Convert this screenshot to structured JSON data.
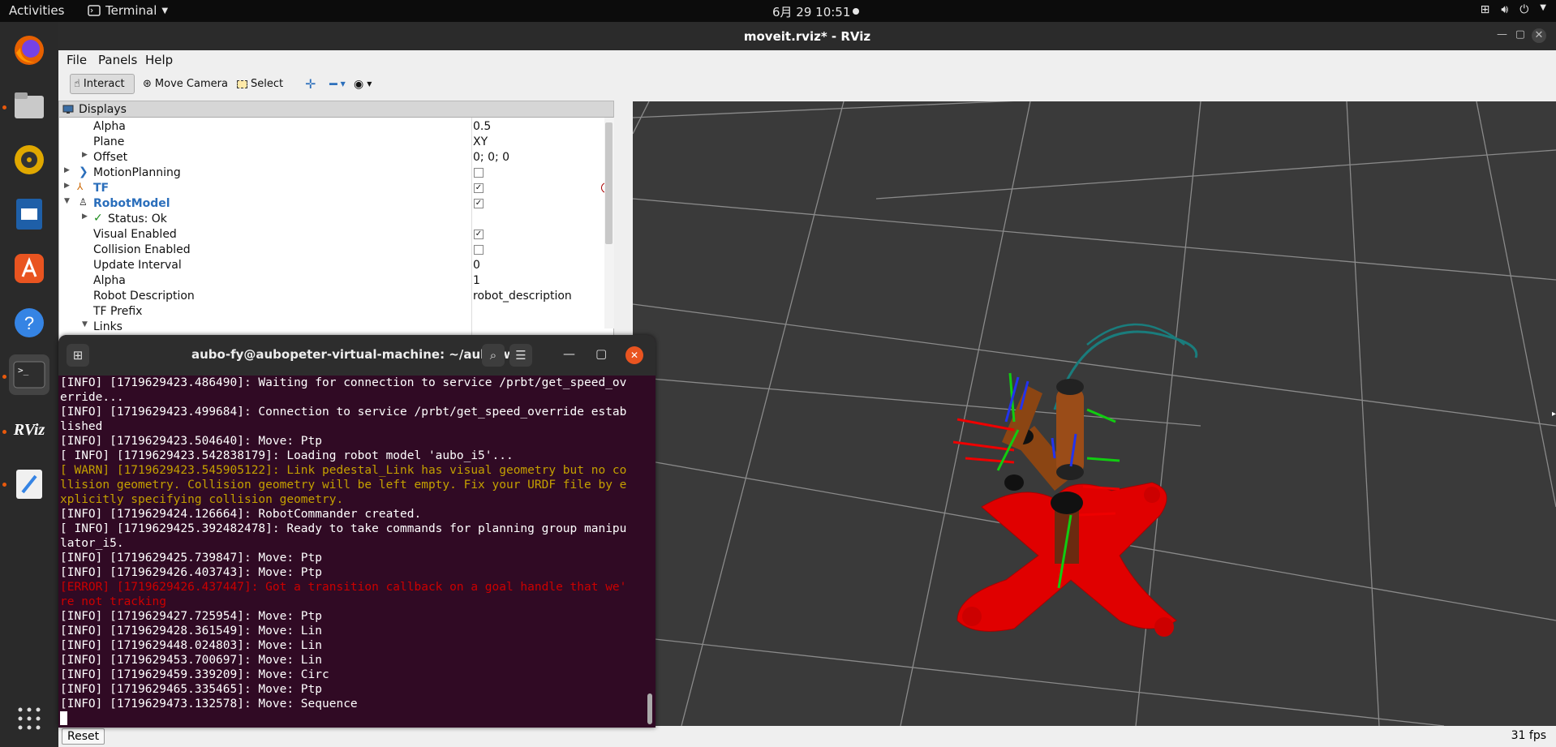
{
  "topbar": {
    "activities": "Activities",
    "app": "Terminal",
    "clock": "6月 29  10:51"
  },
  "dock": {
    "items": [
      "firefox-icon",
      "files-icon",
      "rhythmbox-icon",
      "libreoffice-impress-icon",
      "app-center-icon",
      "help-icon",
      "terminal-icon",
      "rviz-icon",
      "text-editor-icon",
      "show-apps-icon"
    ],
    "rviz_label": "RViz"
  },
  "rviz": {
    "title": "moveit.rviz* - RViz",
    "menu": {
      "file": "File",
      "panels": "Panels",
      "help": "Help"
    },
    "toolbar": {
      "interact": "Interact",
      "move_camera": "Move Camera",
      "select": "Select"
    },
    "displays": {
      "title": "Displays",
      "rows": [
        {
          "name": "Alpha",
          "value": "0.5"
        },
        {
          "name": "Plane",
          "value": "XY"
        },
        {
          "name": "Offset",
          "value": "0; 0; 0"
        },
        {
          "name": "MotionPlanning",
          "checked": false
        },
        {
          "name": "TF",
          "checked": true
        },
        {
          "name": "RobotModel",
          "checked": true
        },
        {
          "name": "Status: Ok"
        },
        {
          "name": "Visual Enabled",
          "checked": true
        },
        {
          "name": "Collision Enabled",
          "checked": false
        },
        {
          "name": "Update Interval",
          "value": "0"
        },
        {
          "name": "Alpha",
          "value": "1"
        },
        {
          "name": "Robot Description",
          "value": "robot_description"
        },
        {
          "name": "TF Prefix",
          "value": ""
        },
        {
          "name": "Links",
          "value": ""
        }
      ]
    },
    "statusbar": {
      "reset": "Reset",
      "fps": "31 fps"
    }
  },
  "terminal": {
    "title": "aubo-fy@aubopeter-virtual-machine: ~/aubo_ws",
    "lines": [
      {
        "t": "[INFO] [1719629423.486490]: Waiting for connection to service /prbt/get_speed_ov",
        "c": ""
      },
      {
        "t": "erride...",
        "c": ""
      },
      {
        "t": "[INFO] [1719629423.499684]: Connection to service /prbt/get_speed_override estab",
        "c": ""
      },
      {
        "t": "lished",
        "c": ""
      },
      {
        "t": "[INFO] [1719629423.504640]: Move: Ptp",
        "c": ""
      },
      {
        "t": "[ INFO] [1719629423.542838179]: Loading robot model 'aubo_i5'...",
        "c": ""
      },
      {
        "t": "[ WARN] [1719629423.545905122]: Link pedestal_Link has visual geometry but no co",
        "c": "warn"
      },
      {
        "t": "llision geometry. Collision geometry will be left empty. Fix your URDF file by e",
        "c": "warn"
      },
      {
        "t": "xplicitly specifying collision geometry.",
        "c": "warn"
      },
      {
        "t": "[INFO] [1719629424.126664]: RobotCommander created.",
        "c": ""
      },
      {
        "t": "[ INFO] [1719629425.392482478]: Ready to take commands for planning group manipu",
        "c": ""
      },
      {
        "t": "lator_i5.",
        "c": ""
      },
      {
        "t": "[INFO] [1719629425.739847]: Move: Ptp",
        "c": ""
      },
      {
        "t": "[INFO] [1719629426.403743]: Move: Ptp",
        "c": ""
      },
      {
        "t": "[ERROR] [1719629426.437447]: Got a transition callback on a goal handle that we'",
        "c": "err"
      },
      {
        "t": "re not tracking",
        "c": "err"
      },
      {
        "t": "[INFO] [1719629427.725954]: Move: Ptp",
        "c": ""
      },
      {
        "t": "[INFO] [1719629428.361549]: Move: Lin",
        "c": ""
      },
      {
        "t": "[INFO] [1719629448.024803]: Move: Lin",
        "c": ""
      },
      {
        "t": "[INFO] [1719629453.700697]: Move: Lin",
        "c": ""
      },
      {
        "t": "[INFO] [1719629459.339209]: Move: Circ",
        "c": ""
      },
      {
        "t": "[INFO] [1719629465.335465]: Move: Ptp",
        "c": ""
      },
      {
        "t": "[INFO] [1719629473.132578]: Move: Sequence",
        "c": ""
      }
    ]
  },
  "colors": {
    "terminal_bg": "#300a24",
    "warn": "#c4a000",
    "error": "#cc0000",
    "robot_base": "#e00000",
    "robot_arm": "#8b4513",
    "link_blue": "#2563eb"
  }
}
